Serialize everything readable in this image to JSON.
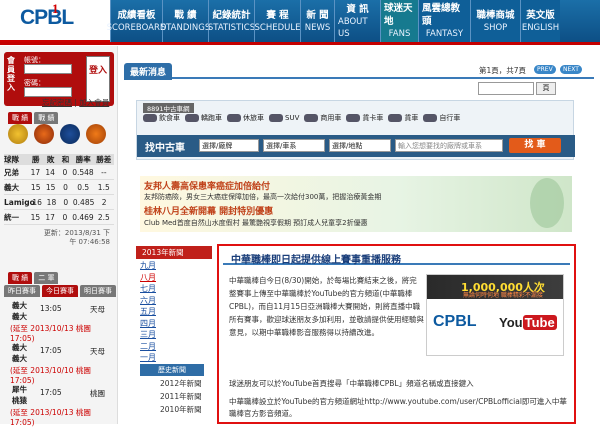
{
  "header": {
    "logo": {
      "brand_a": "CP",
      "brand_b": "BL",
      "brand_mark": "1"
    },
    "nav": [
      {
        "zh": "成績看板",
        "en": "SCOREBOARD"
      },
      {
        "zh": "戰 績",
        "en": "STANDINGS"
      },
      {
        "zh": "紀錄統計",
        "en": "STATISTICS"
      },
      {
        "zh": "賽 程",
        "en": "SCHEDULE"
      },
      {
        "zh": "新 聞",
        "en": "NEWS"
      },
      {
        "zh": "資 訊",
        "en": "ABOUT US"
      },
      {
        "zh": "球迷天地",
        "en": "FANS"
      },
      {
        "zh": "風雲總教頭",
        "en": "FANTASY"
      },
      {
        "zh": "職棒商城",
        "en": "SHOP"
      },
      {
        "zh": "英文版",
        "en": "ENGLISH"
      }
    ]
  },
  "login": {
    "vertical_label": "會員登入",
    "account_label": "帳號：",
    "password_label": "密碼：",
    "login_button": "登入",
    "forgot_link": "忘記密碼",
    "join_link": "加入會員"
  },
  "standings": {
    "tabs": [
      "戰 績",
      "戰 績"
    ],
    "headers": [
      "球隊",
      "勝",
      "敗",
      "和",
      "勝率",
      "勝差"
    ],
    "rows": [
      [
        "兄弟",
        "17",
        "14",
        "0",
        "0.548",
        "--"
      ],
      [
        "義大",
        "15",
        "15",
        "0",
        "0.5",
        "1.5"
      ],
      [
        "Lamigo",
        "16",
        "18",
        "0",
        "0.485",
        "2"
      ],
      [
        "統一",
        "15",
        "17",
        "0",
        "0.469",
        "2.5"
      ]
    ],
    "updated_label": "更新：2013/8/31 下午 07:46:58"
  },
  "games": {
    "tabs": [
      "戰 績",
      "二 軍"
    ],
    "day_tabs": [
      "昨日賽事",
      "今日賽事",
      "明日賽事"
    ],
    "items": [
      {
        "team": "義大",
        "vs": "義大",
        "time": "13:05",
        "place": "天母",
        "note": "(延至 2013/10/13 桃園 17:05)"
      },
      {
        "team": "義大",
        "vs": "義大",
        "time": "17:05",
        "place": "天母",
        "note": "(延至 2013/10/10 桃園 17:05)"
      },
      {
        "team": "犀牛",
        "vs": "桃猿",
        "time": "17:05",
        "place": "桃園",
        "note": "(延至 2013/10/13 桃園 17:05)"
      }
    ]
  },
  "news": {
    "tab_label": "最新消息",
    "page_info": "第1頁，共7頁",
    "prev": "PREV",
    "next": "NEXT",
    "filter_button": "頁"
  },
  "car_widget": {
    "header": "8891中古車網",
    "categories": [
      "飲食車",
      "轎跑車",
      "休旅車",
      "SUV",
      "商用車",
      "貨卡車",
      "貨車",
      "自行車"
    ],
    "search_label": "找中古車",
    "selects": [
      "選擇/廠牌",
      "選擇/車系",
      "選擇/地點"
    ],
    "keyword_placeholder": "輸入您想要找的廠牌或車系",
    "search_button": "找 車"
  },
  "ad": {
    "line1": "友邦人壽高保患率癌症加倍給付",
    "line2": "友邦防癌險，男女三大癌症保障加倍，最高一次給付300萬，把握治療黃金期",
    "line3": "桂林八月全新開幕 開封特別優惠",
    "line4": "Club Med首度自然山水度假村 最驚艷視享假期 預訂成人兒童享2折優惠"
  },
  "months": {
    "year_label": "2013年新聞",
    "list": [
      "九月",
      "八月",
      "七月",
      "六月",
      "五月",
      "四月",
      "三月",
      "二月",
      "一月"
    ],
    "archive_label": "歷史新聞",
    "years": [
      "2012年新聞",
      "2011年新聞",
      "2010年新聞"
    ]
  },
  "article": {
    "title": "中華職棒即日起提供線上賽事重播服務",
    "body": "中華職棒自今日(8/30)開始，於每場比賽結束之後，將完整賽事上傳至中華職棒於YouTube的官方頻道(中華職棒CPBL)，而自11月15日亞洲職棒大賽開始，則將直播中職所有賽事，歡迎球迷朋友多加利用，並敬請提供使用經驗與意見，以期中華職棒影音服務得以持續改進。",
    "para2": "球迷朋友可以於YouTube首頁搜尋「中華職棒CPBL」頻道名稱或直接鍵入",
    "para3": "中華職棒設立於YouTube的官方頻道網址http://www.youtube.com/user/CPBLofficial即可進入中華職棒官方影音頻道。",
    "video_count": "1,000,000人次",
    "video_sub": "無論何時何地 職棒精彩不漏接",
    "video_brand": "CPBL",
    "yt_you": "You",
    "yt_tube": "Tube"
  }
}
